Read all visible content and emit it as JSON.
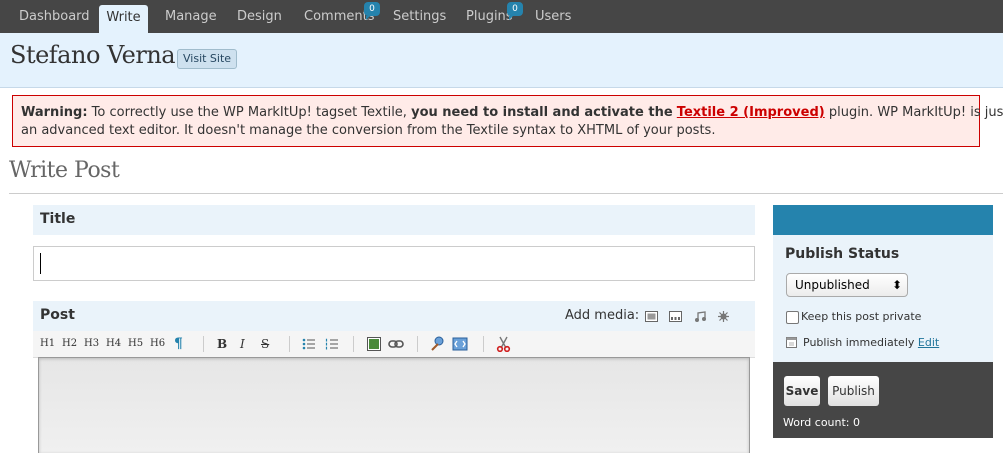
{
  "nav": {
    "items": [
      {
        "label": "Dashboard"
      },
      {
        "label": "Write"
      },
      {
        "label": "Manage"
      },
      {
        "label": "Design"
      },
      {
        "label": "Comments",
        "badge": "0"
      },
      {
        "label": "Settings"
      },
      {
        "label": "Plugins",
        "badge": "0"
      },
      {
        "label": "Users"
      }
    ]
  },
  "header": {
    "blog_name": "Stefano Verna",
    "visit_site": "Visit Site"
  },
  "warning": {
    "label": "Warning:",
    "text1": "To correctly use the WP MarkItUp! tagset Textile,",
    "bold1": "you need to install and activate the",
    "link": "Textile 2 (Improved)",
    "text2": "plugin. WP MarkItUp! is just",
    "line2": "an advanced text editor. It doesn't manage the conversion from the Textile syntax to XHTML of your posts."
  },
  "page": {
    "title": "Write Post"
  },
  "title_box": {
    "label": "Title",
    "value": ""
  },
  "post_box": {
    "label": "Post",
    "add_media": "Add media:",
    "toolbar": [
      "H1",
      "H2",
      "H3",
      "H4",
      "H5",
      "H6",
      "¶",
      "B",
      "I",
      "S"
    ]
  },
  "publish": {
    "title": "Publish Status",
    "status": "Unpublished",
    "private_label": "Keep this post private",
    "publish_when": "Publish immediately",
    "edit": "Edit",
    "save": "Save",
    "publish": "Publish",
    "word_count": "Word count: 0"
  },
  "colors": {
    "nav_bg": "#464646",
    "header_bg": "#e4f2fd",
    "accent": "#2583ad",
    "warning_border": "#cc0000"
  }
}
